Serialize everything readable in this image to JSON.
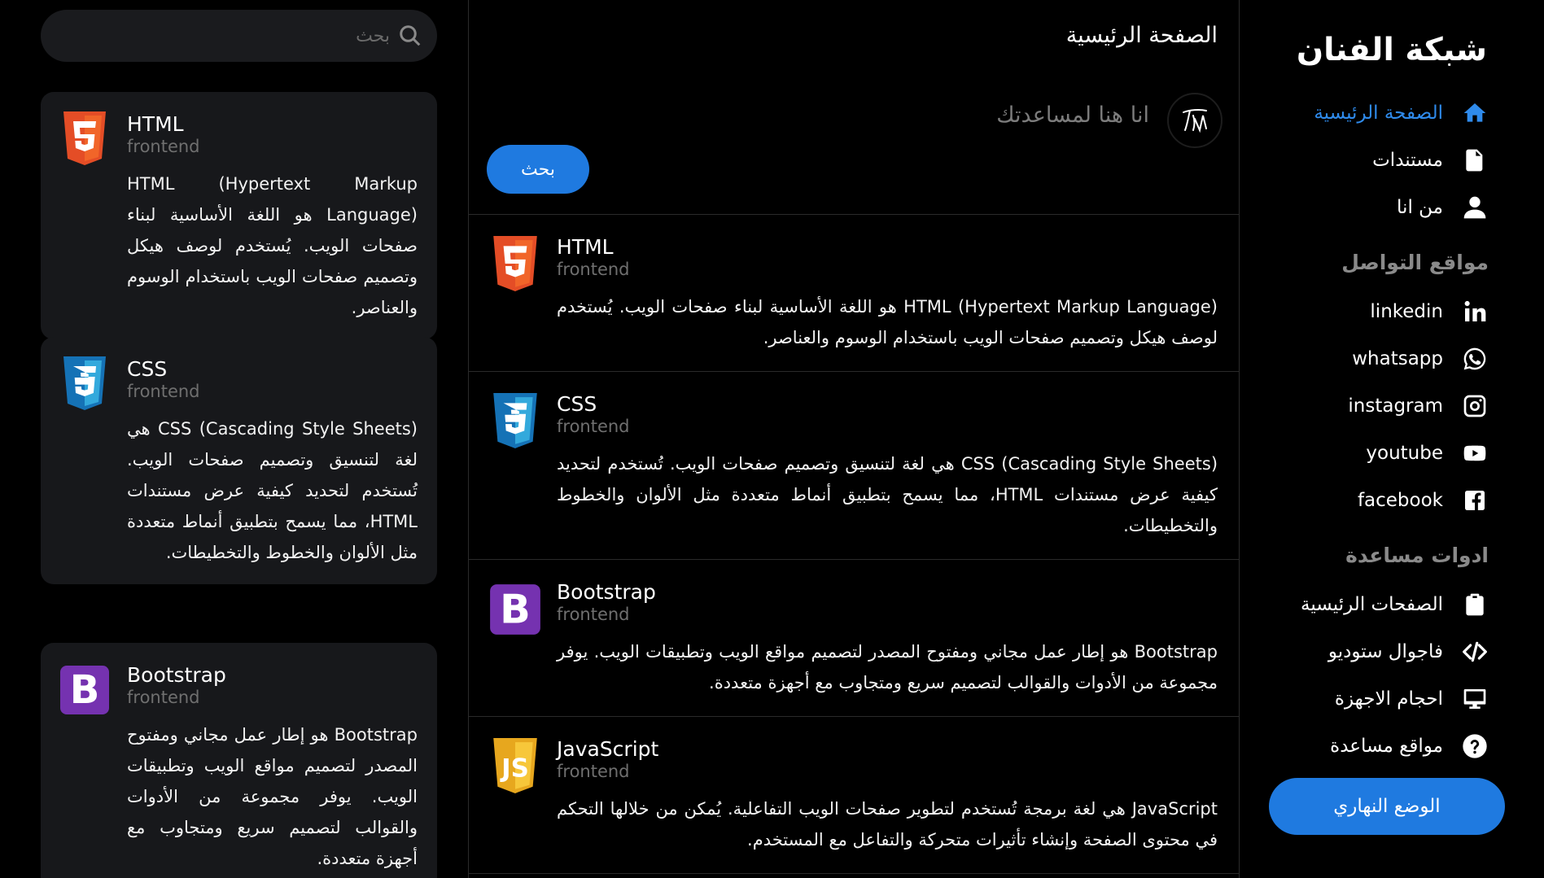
{
  "sidebar": {
    "brand": "شبكة الفنان",
    "nav": [
      {
        "label": "الصفحة الرئيسية",
        "icon": "home-icon",
        "active": true
      },
      {
        "label": "مستندات",
        "icon": "document-icon"
      },
      {
        "label": "من انا",
        "icon": "user-icon"
      }
    ],
    "social_title": "مواقع التواصل",
    "social": [
      {
        "label": "linkedin",
        "icon": "linkedin-icon"
      },
      {
        "label": "whatsapp",
        "icon": "whatsapp-icon"
      },
      {
        "label": "instagram",
        "icon": "instagram-icon"
      },
      {
        "label": "youtube",
        "icon": "youtube-icon"
      },
      {
        "label": "facebook",
        "icon": "facebook-icon"
      }
    ],
    "tools_title": "ادوات مساعدة",
    "tools": [
      {
        "label": "الصفحات الرئيسية",
        "icon": "clipboard-icon"
      },
      {
        "label": "فاجوال ستوديو",
        "icon": "code-icon"
      },
      {
        "label": "احجام الاجهزة",
        "icon": "monitor-icon"
      },
      {
        "label": "مواقع مساعدة",
        "icon": "help-icon"
      }
    ],
    "mode_button": "الوضع النهاري"
  },
  "feed": {
    "header": "الصفحة الرئيسية",
    "composer_prompt": "انا هنا لمساعدتك",
    "post_button": "بحث",
    "posts": [
      {
        "title": "HTML",
        "sub": "frontend",
        "logo": "html5-logo",
        "body": "HTML (Hypertext Markup Language) هو اللغة الأساسية لبناء صفحات الويب. يُستخدم لوصف هيكل وتصميم صفحات الويب باستخدام الوسوم والعناصر."
      },
      {
        "title": "CSS",
        "sub": "frontend",
        "logo": "css3-logo",
        "body": "CSS (Cascading Style Sheets) هي لغة لتنسيق وتصميم صفحات الويب. تُستخدم لتحديد كيفية عرض مستندات HTML، مما يسمح بتطبيق أنماط متعددة مثل الألوان والخطوط والتخطيطات."
      },
      {
        "title": "Bootstrap",
        "sub": "frontend",
        "logo": "bootstrap-logo",
        "body": "Bootstrap هو إطار عمل مجاني ومفتوح المصدر لتصميم مواقع الويب وتطبيقات الويب. يوفر مجموعة من الأدوات والقوالب لتصميم سريع ومتجاوب مع أجهزة متعددة."
      },
      {
        "title": "JavaScript",
        "sub": "frontend",
        "logo": "javascript-logo",
        "body": "JavaScript هي لغة برمجة تُستخدم لتطوير صفحات الويب التفاعلية. يُمكن من خلالها التحكم في محتوى الصفحة وإنشاء تأثيرات متحركة والتفاعل مع المستخدم."
      }
    ]
  },
  "left": {
    "search_placeholder": "بحث",
    "cards": [
      {
        "title": "HTML",
        "sub": "frontend",
        "logo": "html5-logo",
        "body": "HTML (Hypertext Markup Language) هو اللغة الأساسية لبناء صفحات الويب. يُستخدم لوصف هيكل وتصميم صفحات الويب باستخدام الوسوم والعناصر."
      },
      {
        "title": "CSS",
        "sub": "frontend",
        "logo": "css3-logo",
        "body": "CSS (Cascading Style Sheets) هي لغة لتنسيق وتصميم صفحات الويب. تُستخدم لتحديد كيفية عرض مستندات HTML، مما يسمح بتطبيق أنماط متعددة مثل الألوان والخطوط والتخطيطات."
      },
      {
        "title": "Bootstrap",
        "sub": "frontend",
        "logo": "bootstrap-logo",
        "body": "Bootstrap هو إطار عمل مجاني ومفتوح المصدر لتصميم مواقع الويب وتطبيقات الويب. يوفر مجموعة من الأدوات والقوالب لتصميم سريع ومتجاوب مع أجهزة متعددة."
      }
    ]
  },
  "colors": {
    "accent": "#1f7ae0",
    "active_link": "#2f8bec",
    "card_bg": "#17181b"
  }
}
